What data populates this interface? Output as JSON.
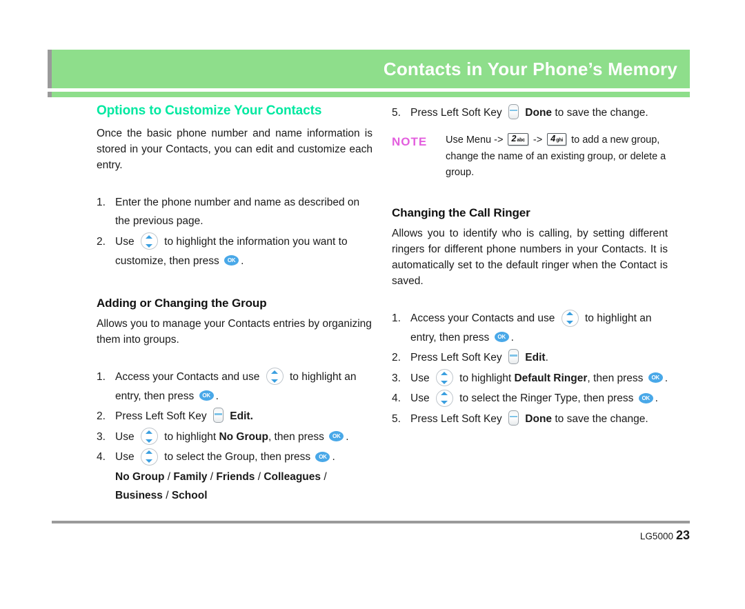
{
  "header": {
    "title": "Contacts in Your Phone’s Memory",
    "bar_color": "#8ede8b",
    "edge_color": "#9a9a9a"
  },
  "left_column": {
    "accent_heading": "Options to Customize Your Contacts",
    "accent_color": "#00e8a0",
    "intro": "Once the basic phone number and name information is stored in your Contacts, you can edit and customize each entry.",
    "steps": [
      {
        "num": "1.",
        "parts": [
          {
            "t": "text",
            "v": "Enter the phone number and name as described on the previous page."
          }
        ]
      },
      {
        "num": "2.",
        "parts": [
          {
            "t": "text",
            "v": "Use "
          },
          {
            "t": "icon",
            "v": "nav-updown-icon"
          },
          {
            "t": "text",
            "v": " to highlight the information you want to customize, then press "
          },
          {
            "t": "icon",
            "v": "ok-icon"
          },
          {
            "t": "text",
            "v": "."
          }
        ]
      }
    ],
    "subsection": {
      "heading": "Adding or Changing the Group",
      "intro": "Allows you to manage your Contacts entries by organizing them into groups.",
      "steps": [
        {
          "num": "1.",
          "parts": [
            {
              "t": "text",
              "v": "Access your Contacts and use "
            },
            {
              "t": "icon",
              "v": "nav-updown-icon"
            },
            {
              "t": "text",
              "v": " to highlight an entry, then press "
            },
            {
              "t": "icon",
              "v": "ok-icon"
            },
            {
              "t": "text",
              "v": "."
            }
          ]
        },
        {
          "num": "2.",
          "parts": [
            {
              "t": "text",
              "v": "Press Left Soft Key "
            },
            {
              "t": "icon",
              "v": "soft-key-icon"
            },
            {
              "t": "bold",
              "v": " Edit."
            }
          ]
        },
        {
          "num": "3.",
          "parts": [
            {
              "t": "text",
              "v": "Use "
            },
            {
              "t": "icon",
              "v": "nav-updown-icon"
            },
            {
              "t": "text",
              "v": " to highlight "
            },
            {
              "t": "bold",
              "v": "No Group"
            },
            {
              "t": "text",
              "v": ", then press "
            },
            {
              "t": "icon",
              "v": "ok-icon"
            },
            {
              "t": "text",
              "v": "."
            }
          ]
        },
        {
          "num": "4.",
          "parts": [
            {
              "t": "text",
              "v": "Use "
            },
            {
              "t": "icon",
              "v": "nav-updown-icon"
            },
            {
              "t": "text",
              "v": " to select the Group, then press "
            },
            {
              "t": "icon",
              "v": "ok-icon"
            },
            {
              "t": "text",
              "v": "."
            }
          ]
        }
      ],
      "group_options": [
        "No Group",
        "Family",
        "Friends",
        "Colleagues",
        "Business",
        "School"
      ],
      "group_separator": " / "
    }
  },
  "right_column": {
    "step5_top": {
      "num": "5.",
      "parts": [
        {
          "t": "text",
          "v": "Press Left Soft Key "
        },
        {
          "t": "icon",
          "v": "soft-key-icon"
        },
        {
          "t": "bold",
          "v": " Done"
        },
        {
          "t": "text",
          "v": " to save the change."
        }
      ]
    },
    "note": {
      "label": "NOTE",
      "label_color": "#e35ede",
      "parts": [
        {
          "t": "text",
          "v": "Use Menu -> "
        },
        {
          "t": "key",
          "num": "2",
          "sub": "abc"
        },
        {
          "t": "text",
          "v": " -> "
        },
        {
          "t": "key",
          "num": "4",
          "sub": "ghi"
        },
        {
          "t": "text",
          "v": " to add a new group, change the name of an existing group, or delete a group."
        }
      ]
    },
    "subsection": {
      "heading": "Changing the Call Ringer",
      "intro": "Allows you to identify who is calling, by setting different ringers for different phone numbers in your Contacts. It is automatically set to the default ringer when the Contact is saved.",
      "steps": [
        {
          "num": "1.",
          "parts": [
            {
              "t": "text",
              "v": "Access your Contacts and use "
            },
            {
              "t": "icon",
              "v": "nav-updown-icon"
            },
            {
              "t": "text",
              "v": " to highlight an entry, then press "
            },
            {
              "t": "icon",
              "v": "ok-icon"
            },
            {
              "t": "text",
              "v": "."
            }
          ]
        },
        {
          "num": "2.",
          "parts": [
            {
              "t": "text",
              "v": "Press Left Soft Key "
            },
            {
              "t": "icon",
              "v": "soft-key-icon"
            },
            {
              "t": "bold",
              "v": " Edit"
            },
            {
              "t": "text",
              "v": "."
            }
          ]
        },
        {
          "num": "3.",
          "parts": [
            {
              "t": "text",
              "v": "Use "
            },
            {
              "t": "icon",
              "v": "nav-updown-icon"
            },
            {
              "t": "text",
              "v": " to highlight "
            },
            {
              "t": "bold",
              "v": "Default Ringer"
            },
            {
              "t": "text",
              "v": ", then press "
            },
            {
              "t": "icon",
              "v": "ok-icon"
            },
            {
              "t": "text",
              "v": "."
            }
          ]
        },
        {
          "num": "4.",
          "parts": [
            {
              "t": "text",
              "v": "Use "
            },
            {
              "t": "icon",
              "v": "nav-updown-icon"
            },
            {
              "t": "text",
              "v": " to select the Ringer Type, then press "
            },
            {
              "t": "icon",
              "v": "ok-icon"
            },
            {
              "t": "text",
              "v": "."
            }
          ]
        },
        {
          "num": "5.",
          "parts": [
            {
              "t": "text",
              "v": "Press Left Soft Key "
            },
            {
              "t": "icon",
              "v": "soft-key-icon"
            },
            {
              "t": "bold",
              "v": " Done"
            },
            {
              "t": "text",
              "v": " to save the change."
            }
          ]
        }
      ]
    }
  },
  "footer": {
    "model": "LG5000",
    "page_number": "23"
  },
  "icon_labels": {
    "ok": "OK"
  }
}
